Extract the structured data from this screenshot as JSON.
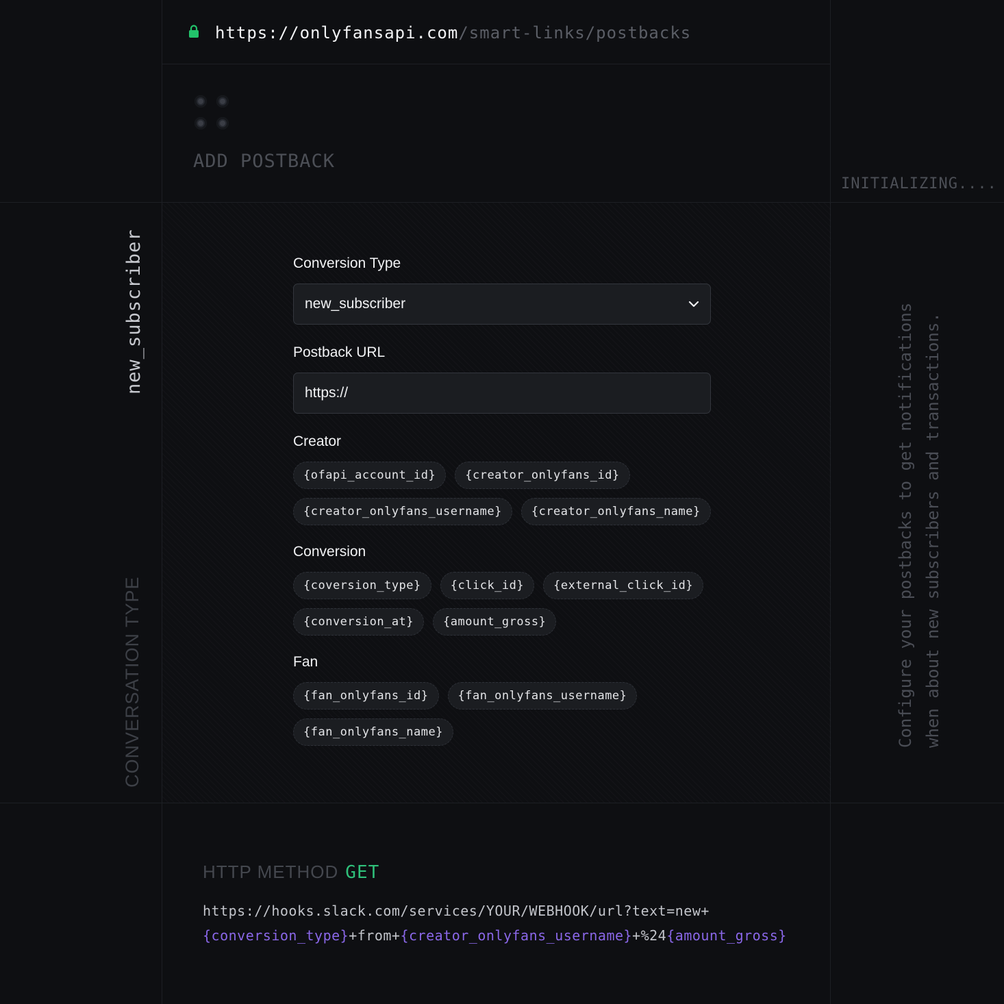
{
  "urlbar": {
    "host": "https://onlyfansapi.com",
    "path": "/smart-links/postbacks",
    "lock_icon_color": "#22c36b"
  },
  "header": {
    "title": "ADD POSTBACK",
    "status": "INITIALIZING...."
  },
  "side": {
    "selected_type": "new_subscriber",
    "type_label": "CONVERSATION TYPE",
    "description": "Configure your postbacks to get notifications when about new subscribers and transactions."
  },
  "form": {
    "conversion_type_label": "Conversion Type",
    "conversion_type_value": "new_subscriber",
    "postback_url_label": "Postback URL",
    "postback_url_value": "https://",
    "groups": [
      {
        "label": "Creator",
        "chips": [
          "{ofapi_account_id}",
          "{creator_onlyfans_id}",
          "{creator_onlyfans_username}",
          "{creator_onlyfans_name}"
        ]
      },
      {
        "label": "Conversion",
        "chips": [
          "{coversion_type}",
          "{click_id}",
          "{external_click_id}",
          "{conversion_at}",
          "{amount_gross}"
        ]
      },
      {
        "label": "Fan",
        "chips": [
          "{fan_onlyfans_id}",
          "{fan_onlyfans_username}",
          "{fan_onlyfans_name}"
        ]
      }
    ]
  },
  "preview": {
    "method_label": "HTTP METHOD",
    "method": "GET",
    "url_parts": [
      {
        "text": "https://hooks.slack.com/services/YOUR/WEBHOOK/url?text=new+",
        "placeholder": false
      },
      {
        "text": "{conversion_type}",
        "placeholder": true
      },
      {
        "text": "+from+",
        "placeholder": false
      },
      {
        "text": "{creator_onlyfans_username}",
        "placeholder": true
      },
      {
        "text": "+%24",
        "placeholder": false
      },
      {
        "text": "{amount_gross}",
        "placeholder": true
      }
    ],
    "accent_color": "#2fc07a",
    "placeholder_color": "#8a67e8"
  }
}
